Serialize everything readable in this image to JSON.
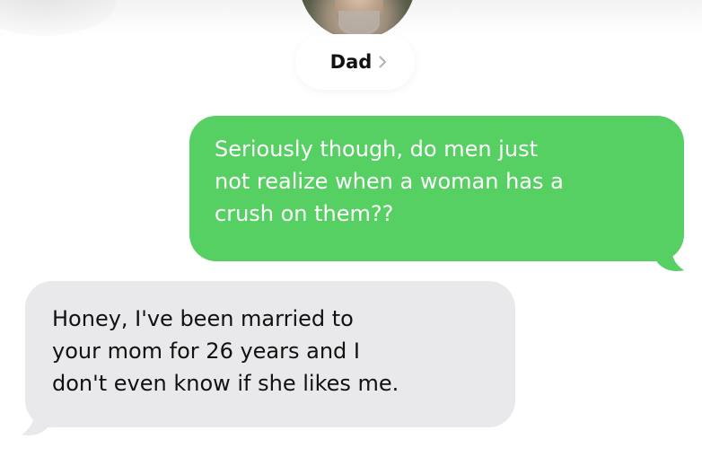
{
  "header": {
    "contact_name": "Dad",
    "avatar_icon": "contact-photo-icon",
    "chevron_icon": "chevron-right-icon"
  },
  "messages": [
    {
      "direction": "outgoing",
      "color": "#56cf63",
      "lines": [
        "Seriously though, do men just",
        "not realize when a woman has a",
        "crush on them??"
      ]
    },
    {
      "direction": "incoming",
      "color": "#e9e9eb",
      "lines": [
        "Honey, I've been married to",
        "your mom for 26 years and I",
        "don't even know if she likes me."
      ]
    }
  ]
}
